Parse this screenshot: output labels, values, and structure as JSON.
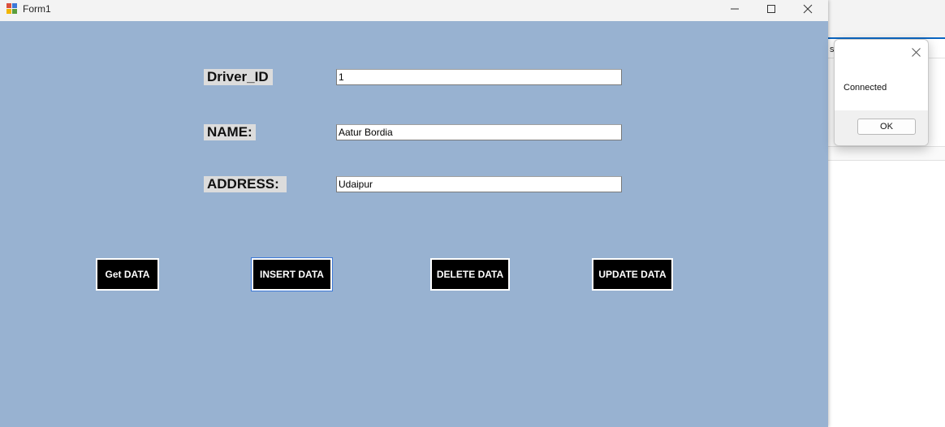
{
  "window": {
    "title": "Form1",
    "icons": {
      "app": "app-icon",
      "minimize": "minimize-icon",
      "maximize": "maximize-icon",
      "close": "close-icon"
    }
  },
  "form": {
    "driver_id": {
      "label": "Driver_ID",
      "value": "1"
    },
    "name": {
      "label": "NAME:",
      "value": "Aatur Bordia"
    },
    "address": {
      "label": "ADDRESS:",
      "value": "Udaipur"
    }
  },
  "buttons": {
    "get": "Get DATA",
    "insert": "INSERT DATA",
    "delete": "DELETE DATA",
    "update": "UPDATE DATA"
  },
  "message_box": {
    "text": "Connected",
    "ok_label": "OK"
  },
  "background_window": {
    "tab_fragment": "s"
  },
  "colors": {
    "form_background": "#98b2d1",
    "button_background": "#000000",
    "button_text": "#ffffff",
    "label_background": "#dcdcdc",
    "accent": "#0a66c2"
  }
}
